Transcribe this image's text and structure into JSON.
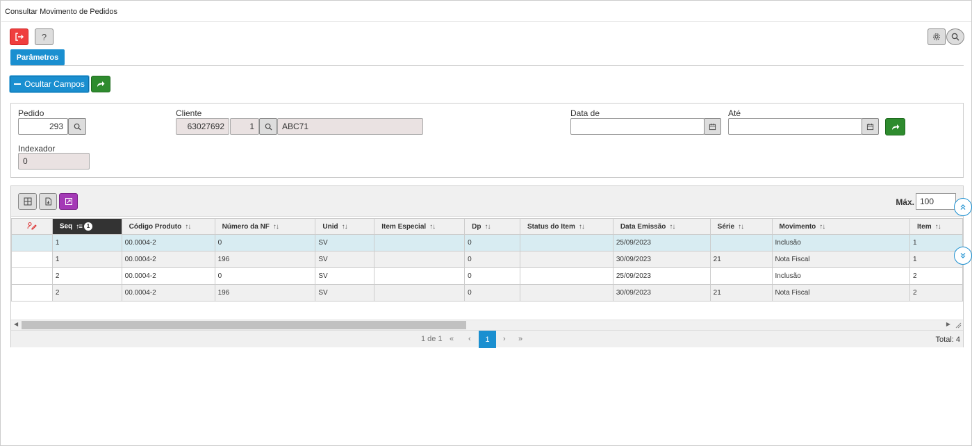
{
  "window": {
    "title": "Consultar Movimento de Pedidos"
  },
  "toolbar": {
    "exit_icon": "exit-icon",
    "help_icon": "help-icon",
    "settings_icon": "gear-icon",
    "search_icon": "search-icon"
  },
  "tabs": {
    "params_label": "Parâmetros"
  },
  "actions": {
    "hide_fields_label": "Ocultar Campos"
  },
  "form": {
    "pedido_label": "Pedido",
    "pedido_value": "293",
    "cliente_label": "Cliente",
    "cliente_code": "63027692",
    "cliente_seq": "1",
    "cliente_name": "ABC71",
    "data_de_label": "Data de",
    "data_de_value": "",
    "ate_label": "Até",
    "ate_value": "",
    "indexador_label": "Indexador",
    "indexador_value": "0"
  },
  "grid": {
    "max_label": "Máx.",
    "max_value": "100",
    "sort_badge": "1",
    "columns": [
      "Seq",
      "Código Produto",
      "Número da NF",
      "Unid",
      "Item Especial",
      "Dp",
      "Status do Item",
      "Data Emissão",
      "Série",
      "Movimento",
      "Item"
    ],
    "rows": [
      [
        "1",
        "00.0004-2",
        "0",
        "SV",
        "",
        "0",
        "",
        "25/09/2023",
        "",
        "Inclusão",
        "1"
      ],
      [
        "1",
        "00.0004-2",
        "196",
        "SV",
        "",
        "0",
        "",
        "30/09/2023",
        "21",
        "Nota Fiscal",
        "1"
      ],
      [
        "2",
        "00.0004-2",
        "0",
        "SV",
        "",
        "0",
        "",
        "25/09/2023",
        "",
        "Inclusão",
        "2"
      ],
      [
        "2",
        "00.0004-2",
        "196",
        "SV",
        "",
        "0",
        "",
        "30/09/2023",
        "21",
        "Nota Fiscal",
        "2"
      ]
    ]
  },
  "pager": {
    "page_info": "1 de 1",
    "first": "«",
    "prev": "‹",
    "current": "1",
    "next": "›",
    "last": "»",
    "total": "Total: 4"
  },
  "colors": {
    "accent": "#1a8fd0",
    "danger": "#ef3e3e",
    "success": "#2e8b2e",
    "purple": "#a43ab6",
    "selected_row": "#d8ecf2",
    "active_header": "#333333"
  }
}
